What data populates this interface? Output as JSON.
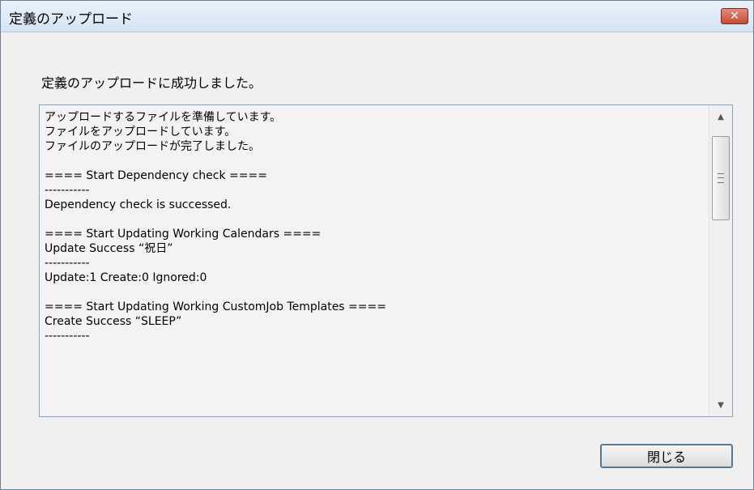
{
  "window": {
    "title": "定義のアップロード",
    "close_glyph": "✕"
  },
  "message": "定義のアップロードに成功しました。",
  "log": {
    "lines": [
      "アップロードするファイルを準備しています。",
      "ファイルをアップロードしています。",
      "ファイルのアップロードが完了しました。",
      "",
      "==== Start Dependency check ====",
      "-----------",
      "Dependency check is successed.",
      "",
      "==== Start Updating Working Calendars ====",
      "Update Success “祝日”",
      "-----------",
      "Update:1 Create:0 Ignored:0",
      "",
      "==== Start Updating Working CustomJob Templates ====",
      "Create Success “SLEEP”",
      "-----------"
    ],
    "scroll_up_glyph": "▲",
    "scroll_down_glyph": "▼"
  },
  "buttons": {
    "close_label": "閉じる"
  }
}
